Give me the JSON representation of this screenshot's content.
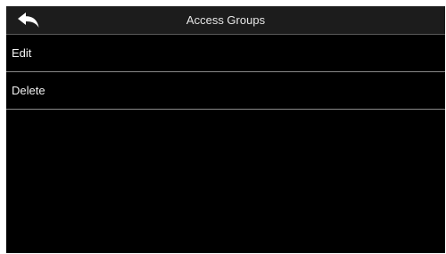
{
  "header": {
    "title": "Access Groups",
    "back_icon": "back-arrow-icon"
  },
  "menu": {
    "items": [
      {
        "label": "Edit"
      },
      {
        "label": "Delete"
      }
    ]
  },
  "colors": {
    "background": "#000000",
    "title_bar": "#1c1c1c",
    "text": "#f2f2f2",
    "divider": "#8a8a8a"
  }
}
